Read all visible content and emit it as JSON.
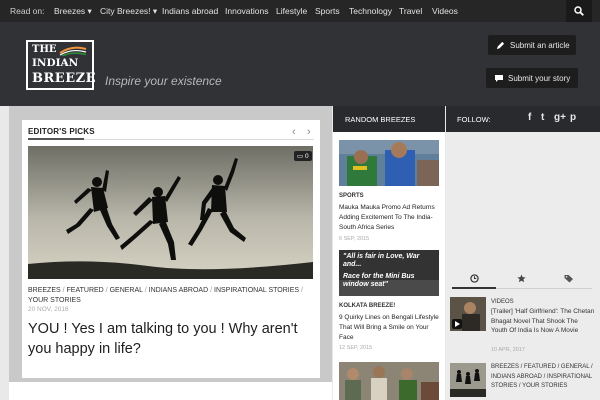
{
  "topnav": {
    "read_on": "Read on:",
    "items": [
      {
        "label": "Breezes ▾"
      },
      {
        "label": "City Breezes! ▾"
      },
      {
        "label": "Indians abroad"
      },
      {
        "label": "Innovations"
      },
      {
        "label": "Lifestyle"
      },
      {
        "label": "Sports"
      },
      {
        "label": "Technology"
      },
      {
        "label": "Travel"
      },
      {
        "label": "Videos"
      }
    ],
    "search_icon": "search-icon"
  },
  "header": {
    "logo": {
      "line1": "THE",
      "line2": "INDIAN",
      "line3": "BREEZE"
    },
    "tagline": "Inspire your existence",
    "submit_article": "Submit an article",
    "submit_story": "Submit your story"
  },
  "featured": {
    "section_label": "EDITOR'S PICKS",
    "prev_arrow": "‹",
    "next_arrow": "›",
    "comment_count": "0",
    "categories": [
      "BREEZES",
      "FEATURED",
      "GENERAL",
      "INDIANS ABROAD",
      "INSPIRATIONAL STORIES",
      "YOUR STORIES"
    ],
    "date": "20 NOV, 2016",
    "title": "YOU ! Yes I am talking to you ! Why aren't you happy in life?"
  },
  "random_breezes": {
    "heading": "RANDOM BREEZES",
    "posts": [
      {
        "category": "SPORTS",
        "title": "Mauka Mauka Promo Ad Returns Adding Excitement To The India-South Africa Series",
        "date": "6 SEP, 2015"
      },
      {
        "image_text_1": "\"All is fair in Love, War and...",
        "image_text_2": "Race for the Mini Bus window seat\"",
        "category": "KOLKATA BREEZE!",
        "title": "9 Quirky Lines on Bengali Lifestyle That Will Bring a Smile on Your Face",
        "date": "12 SEP, 2015"
      }
    ]
  },
  "follow": {
    "heading": "FOLLOW:",
    "social": [
      "f",
      "t",
      "g+",
      "p"
    ]
  },
  "sidebar": {
    "tabs": [
      "clock-icon",
      "star-icon",
      "tag-icon"
    ],
    "posts": [
      {
        "category": "VIDEOS",
        "title": "[Trailer] 'Half Girlfriend': The Chetan Bhagat Novel That Shook The Youth Of India Is Now A Movie",
        "date": "10 APR, 2017"
      },
      {
        "categories": "BREEZES / FEATURED / GENERAL / INDIANS ABROAD / INSPIRATIONAL STORIES / YOUR STORIES"
      }
    ]
  },
  "colors": {
    "topbar": "#262626",
    "header": "#303236",
    "panel_dark": "#282a2e",
    "accent_saffron": "#f0953a",
    "accent_green": "#2f8a3a"
  }
}
